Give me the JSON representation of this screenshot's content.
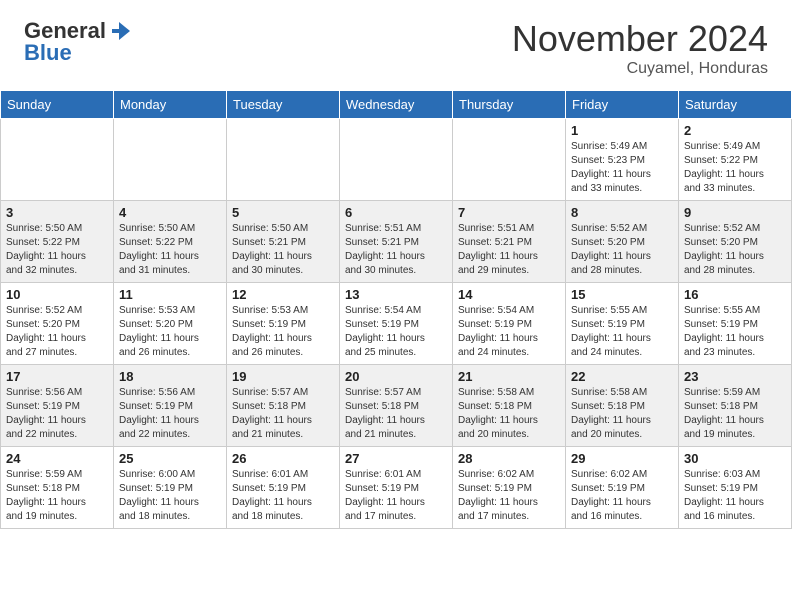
{
  "header": {
    "logo_general": "General",
    "logo_blue": "Blue",
    "month_title": "November 2024",
    "location": "Cuyamel, Honduras"
  },
  "days_of_week": [
    "Sunday",
    "Monday",
    "Tuesday",
    "Wednesday",
    "Thursday",
    "Friday",
    "Saturday"
  ],
  "weeks": [
    [
      {
        "day": "",
        "info": ""
      },
      {
        "day": "",
        "info": ""
      },
      {
        "day": "",
        "info": ""
      },
      {
        "day": "",
        "info": ""
      },
      {
        "day": "",
        "info": ""
      },
      {
        "day": "1",
        "info": "Sunrise: 5:49 AM\nSunset: 5:23 PM\nDaylight: 11 hours\nand 33 minutes."
      },
      {
        "day": "2",
        "info": "Sunrise: 5:49 AM\nSunset: 5:22 PM\nDaylight: 11 hours\nand 33 minutes."
      }
    ],
    [
      {
        "day": "3",
        "info": "Sunrise: 5:50 AM\nSunset: 5:22 PM\nDaylight: 11 hours\nand 32 minutes."
      },
      {
        "day": "4",
        "info": "Sunrise: 5:50 AM\nSunset: 5:22 PM\nDaylight: 11 hours\nand 31 minutes."
      },
      {
        "day": "5",
        "info": "Sunrise: 5:50 AM\nSunset: 5:21 PM\nDaylight: 11 hours\nand 30 minutes."
      },
      {
        "day": "6",
        "info": "Sunrise: 5:51 AM\nSunset: 5:21 PM\nDaylight: 11 hours\nand 30 minutes."
      },
      {
        "day": "7",
        "info": "Sunrise: 5:51 AM\nSunset: 5:21 PM\nDaylight: 11 hours\nand 29 minutes."
      },
      {
        "day": "8",
        "info": "Sunrise: 5:52 AM\nSunset: 5:20 PM\nDaylight: 11 hours\nand 28 minutes."
      },
      {
        "day": "9",
        "info": "Sunrise: 5:52 AM\nSunset: 5:20 PM\nDaylight: 11 hours\nand 28 minutes."
      }
    ],
    [
      {
        "day": "10",
        "info": "Sunrise: 5:52 AM\nSunset: 5:20 PM\nDaylight: 11 hours\nand 27 minutes."
      },
      {
        "day": "11",
        "info": "Sunrise: 5:53 AM\nSunset: 5:20 PM\nDaylight: 11 hours\nand 26 minutes."
      },
      {
        "day": "12",
        "info": "Sunrise: 5:53 AM\nSunset: 5:19 PM\nDaylight: 11 hours\nand 26 minutes."
      },
      {
        "day": "13",
        "info": "Sunrise: 5:54 AM\nSunset: 5:19 PM\nDaylight: 11 hours\nand 25 minutes."
      },
      {
        "day": "14",
        "info": "Sunrise: 5:54 AM\nSunset: 5:19 PM\nDaylight: 11 hours\nand 24 minutes."
      },
      {
        "day": "15",
        "info": "Sunrise: 5:55 AM\nSunset: 5:19 PM\nDaylight: 11 hours\nand 24 minutes."
      },
      {
        "day": "16",
        "info": "Sunrise: 5:55 AM\nSunset: 5:19 PM\nDaylight: 11 hours\nand 23 minutes."
      }
    ],
    [
      {
        "day": "17",
        "info": "Sunrise: 5:56 AM\nSunset: 5:19 PM\nDaylight: 11 hours\nand 22 minutes."
      },
      {
        "day": "18",
        "info": "Sunrise: 5:56 AM\nSunset: 5:19 PM\nDaylight: 11 hours\nand 22 minutes."
      },
      {
        "day": "19",
        "info": "Sunrise: 5:57 AM\nSunset: 5:18 PM\nDaylight: 11 hours\nand 21 minutes."
      },
      {
        "day": "20",
        "info": "Sunrise: 5:57 AM\nSunset: 5:18 PM\nDaylight: 11 hours\nand 21 minutes."
      },
      {
        "day": "21",
        "info": "Sunrise: 5:58 AM\nSunset: 5:18 PM\nDaylight: 11 hours\nand 20 minutes."
      },
      {
        "day": "22",
        "info": "Sunrise: 5:58 AM\nSunset: 5:18 PM\nDaylight: 11 hours\nand 20 minutes."
      },
      {
        "day": "23",
        "info": "Sunrise: 5:59 AM\nSunset: 5:18 PM\nDaylight: 11 hours\nand 19 minutes."
      }
    ],
    [
      {
        "day": "24",
        "info": "Sunrise: 5:59 AM\nSunset: 5:18 PM\nDaylight: 11 hours\nand 19 minutes."
      },
      {
        "day": "25",
        "info": "Sunrise: 6:00 AM\nSunset: 5:19 PM\nDaylight: 11 hours\nand 18 minutes."
      },
      {
        "day": "26",
        "info": "Sunrise: 6:01 AM\nSunset: 5:19 PM\nDaylight: 11 hours\nand 18 minutes."
      },
      {
        "day": "27",
        "info": "Sunrise: 6:01 AM\nSunset: 5:19 PM\nDaylight: 11 hours\nand 17 minutes."
      },
      {
        "day": "28",
        "info": "Sunrise: 6:02 AM\nSunset: 5:19 PM\nDaylight: 11 hours\nand 17 minutes."
      },
      {
        "day": "29",
        "info": "Sunrise: 6:02 AM\nSunset: 5:19 PM\nDaylight: 11 hours\nand 16 minutes."
      },
      {
        "day": "30",
        "info": "Sunrise: 6:03 AM\nSunset: 5:19 PM\nDaylight: 11 hours\nand 16 minutes."
      }
    ]
  ]
}
